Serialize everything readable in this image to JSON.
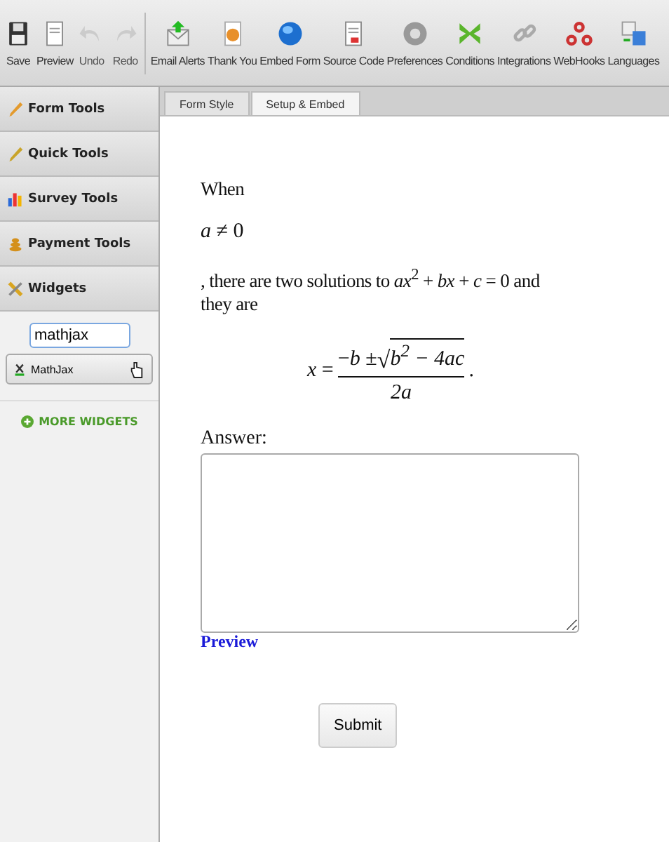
{
  "toolbar": [
    {
      "label": "Save",
      "disabled": false
    },
    {
      "label": "Preview",
      "disabled": false
    },
    {
      "label": "Undo",
      "disabled": true
    },
    {
      "label": "Redo",
      "disabled": true
    },
    {
      "label": "Email Alerts",
      "disabled": false
    },
    {
      "label": "Thank You",
      "disabled": false
    },
    {
      "label": "Embed Form",
      "disabled": false
    },
    {
      "label": "Source Code",
      "disabled": false
    },
    {
      "label": "Preferences",
      "disabled": false
    },
    {
      "label": "Conditions",
      "disabled": false
    },
    {
      "label": "Integrations",
      "disabled": false
    },
    {
      "label": "WebHooks",
      "disabled": false
    },
    {
      "label": "Languages",
      "disabled": false
    }
  ],
  "sidebar": {
    "sections": [
      {
        "label": "Form Tools"
      },
      {
        "label": "Quick Tools"
      },
      {
        "label": "Survey Tools"
      },
      {
        "label": "Payment Tools"
      },
      {
        "label": "Widgets"
      }
    ],
    "widget_search": {
      "value": "mathjax"
    },
    "widget_results": [
      {
        "label": "MathJax"
      }
    ],
    "more_link": "MORE WIDGETS"
  },
  "tabs": [
    {
      "label": "Form Style",
      "selected": false
    },
    {
      "label": "Setup & Embed",
      "selected": true
    }
  ],
  "form": {
    "intro": "When",
    "condition": "*a* ≠ 0",
    "sentence": ", there are two solutions to *ax*$^{2}$ + *bx* + *c* = 0 and they are",
    "formula": {
      "lhs": "*x* =",
      "numerator_prefix": "−*b* ±",
      "radical": "√",
      "radicand": "b$^{2}$ − 4ac",
      "denominator": "2a",
      "trailing": "."
    },
    "answer_label": "Answer:",
    "preview_link": "Preview",
    "submit": "Submit"
  }
}
